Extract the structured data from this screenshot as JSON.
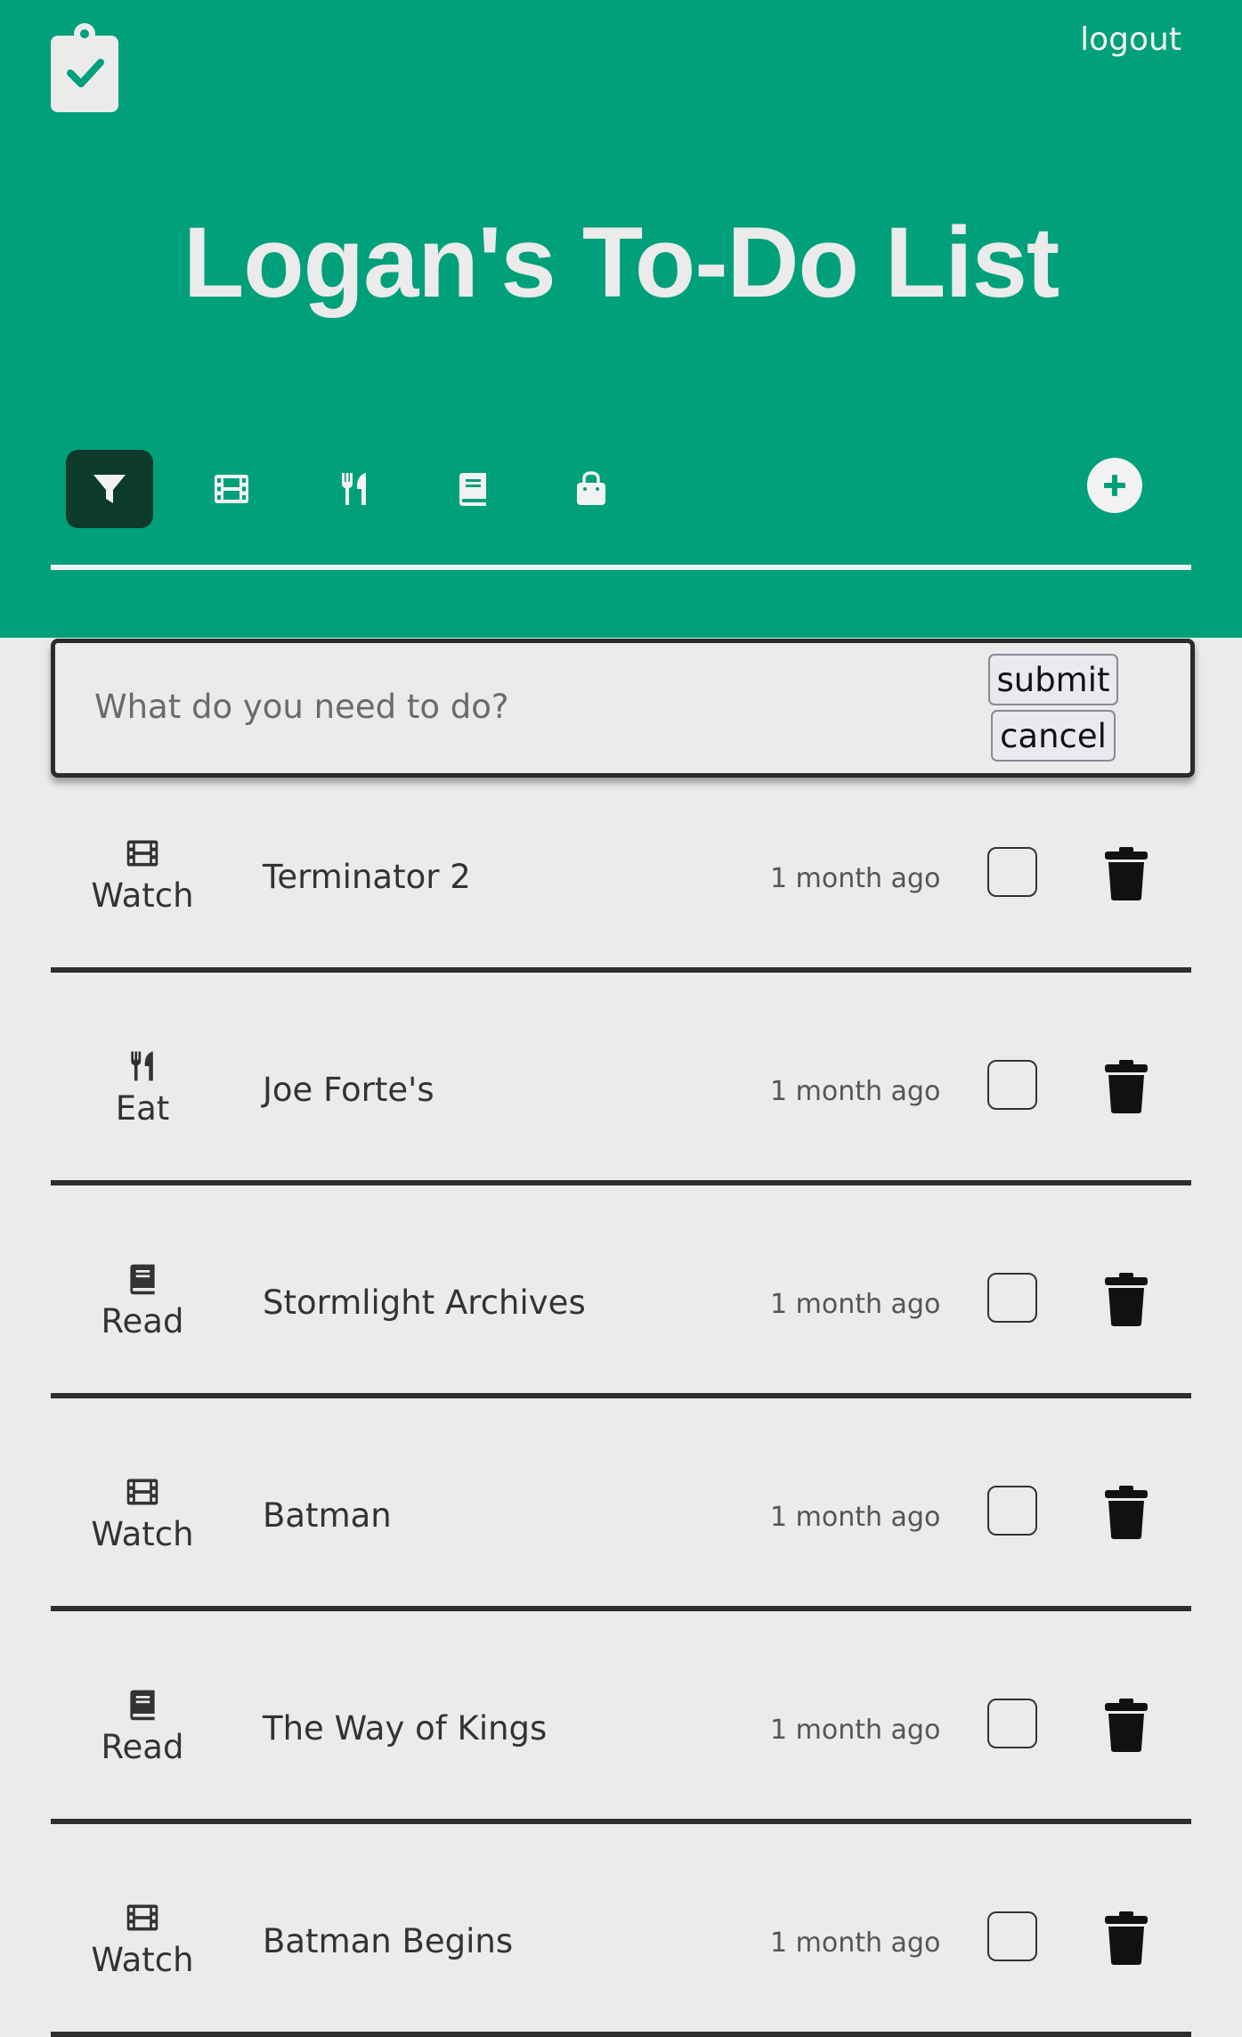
{
  "header": {
    "logout_label": "logout",
    "title": "Logan's To-Do List"
  },
  "filters": [
    {
      "name": "filter-icon",
      "active": true
    },
    {
      "name": "film-icon",
      "active": false
    },
    {
      "name": "utensils-icon",
      "active": false
    },
    {
      "name": "book-icon",
      "active": false
    },
    {
      "name": "shopping-bag-icon",
      "active": false
    }
  ],
  "add_icon": "plus-circle-icon",
  "form": {
    "placeholder": "What do you need to do?",
    "submit_label": "submit",
    "cancel_label": "cancel"
  },
  "todos": [
    {
      "category": "Watch",
      "icon": "film-icon",
      "name": "Terminator 2",
      "time": "1 month ago",
      "done": false
    },
    {
      "category": "Eat",
      "icon": "utensils-icon",
      "name": "Joe Forte's",
      "time": "1 month ago",
      "done": false
    },
    {
      "category": "Read",
      "icon": "book-icon",
      "name": "Stormlight Archives",
      "time": "1 month ago",
      "done": false
    },
    {
      "category": "Watch",
      "icon": "film-icon",
      "name": "Batman",
      "time": "1 month ago",
      "done": false
    },
    {
      "category": "Read",
      "icon": "book-icon",
      "name": "The Way of Kings",
      "time": "1 month ago",
      "done": false
    },
    {
      "category": "Watch",
      "icon": "film-icon",
      "name": "Batman Begins",
      "time": "1 month ago",
      "done": false
    }
  ],
  "colors": {
    "header_bg": "#00a07a",
    "active_filter_bg": "#0d3b2b",
    "page_bg": "#eaecec"
  }
}
